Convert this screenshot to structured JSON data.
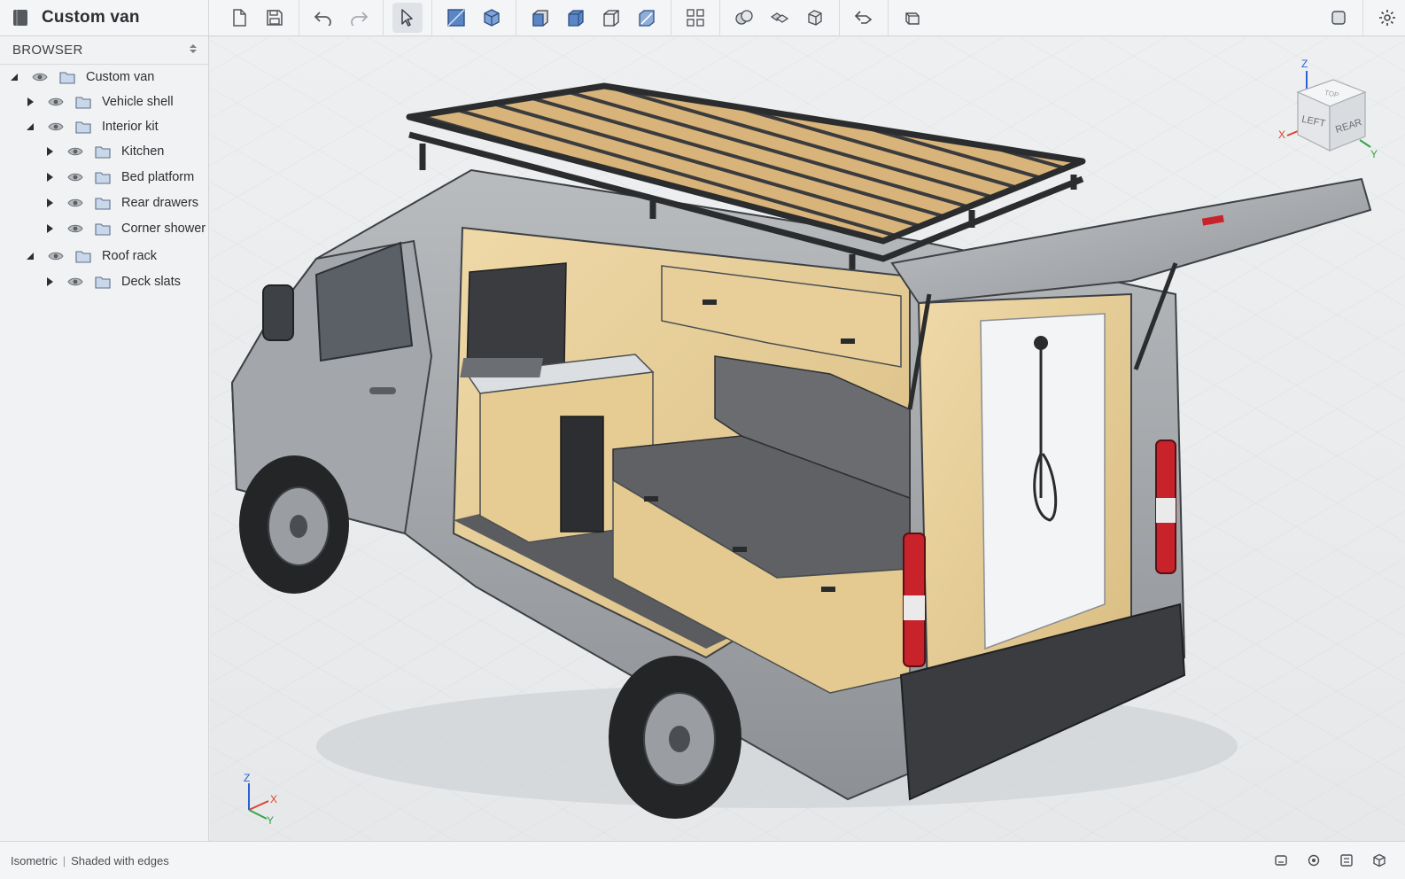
{
  "document": {
    "title": "Custom van"
  },
  "toolbar": {
    "groups": [
      [
        "new-file-icon",
        "save-icon",
        "undo-icon",
        "redo-icon"
      ],
      [
        "select-icon"
      ],
      [
        "sketch-plane-icon",
        "box-icon"
      ],
      [
        "front-view-icon",
        "right-view-icon",
        "left-view-icon",
        "section-view-icon"
      ],
      [
        "grid-icon"
      ],
      [
        "combine-icon",
        "intersect-icon",
        "shell-icon",
        "revert-icon",
        "solid-icon"
      ]
    ]
  },
  "browser": {
    "title": "BROWSER",
    "tree": [
      {
        "label": "Custom van",
        "depth": 0,
        "expanded": true
      },
      {
        "label": "Vehicle shell",
        "depth": 1,
        "expanded": false
      },
      {
        "label": "Interior kit",
        "depth": 1,
        "expanded": true
      },
      {
        "label": "Kitchen",
        "depth": 2,
        "expanded": false
      },
      {
        "label": "Bed platform",
        "depth": 2,
        "expanded": false
      },
      {
        "label": "Rear drawers",
        "depth": 2,
        "expanded": false
      },
      {
        "label": "Corner shower",
        "depth": 2,
        "expanded": false
      },
      {
        "label": "Roof rack",
        "depth": 1,
        "expanded": true
      },
      {
        "label": "Deck slats",
        "depth": 2,
        "expanded": false
      }
    ]
  },
  "viewcube": {
    "faces": {
      "top": "TOP",
      "left": "LEFT",
      "rear": "REAR"
    },
    "axes": {
      "x": "X",
      "y": "Y",
      "z": "Z"
    },
    "colors": {
      "x": "#e0412f",
      "y": "#3aa24a",
      "z": "#2a62d6"
    }
  },
  "triad": {
    "x": "X",
    "y": "Y",
    "z": "Z"
  },
  "status": {
    "view": "Isometric",
    "style": "Shaded with edges"
  },
  "colors": {
    "plywood": "#e8cf9a",
    "van_body": "#a9acaf",
    "cushion": "#5a5c5f",
    "rack": "#2a2c2e",
    "taillight": "#c8232b"
  }
}
